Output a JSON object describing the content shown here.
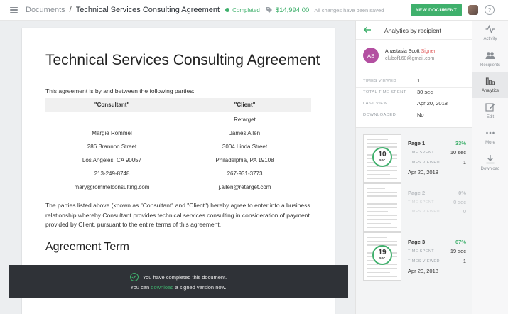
{
  "header": {
    "breadcrumb_root": "Documents",
    "separator": "/",
    "doc_title": "Technical Services Consulting Agreement",
    "status": "Completed",
    "price": "$14,994.00",
    "saved_text": "All changes have been saved",
    "new_document_label": "NEW DOCUMENT",
    "help_label": "?",
    "colors": {
      "accent": "#3fb06c"
    }
  },
  "document": {
    "title": "Technical Services Consulting Agreement",
    "intro": "This agreement is by and between the following parties:",
    "consultant_header": "\"Consultant\"",
    "client_header": "\"Client\"",
    "consultant": [
      "Margie Rommel",
      "286 Brannon Street",
      "Los Angeles, CA 90057",
      "213-249-8748",
      "mary@rommelconsulting.com"
    ],
    "client": [
      "Retarget",
      "James Allen",
      "3004 Linda Street",
      "Philadelphia, PA 19108",
      "267-931-3773",
      "j.allen@retarget.com"
    ],
    "paragraph": "The parties listed above (known as \"Consultant\" and \"Client\") hereby agree to enter into a business relationship whereby Consultant provides technical services consulting in consideration of payment provided by Client, pursuant to the entire terms of this agreement.",
    "section_heading": "Agreement Term"
  },
  "toast": {
    "line1": "You have completed this document.",
    "line2_prefix": "You can ",
    "line2_link": "download",
    "line2_suffix": " a signed version now."
  },
  "analytics": {
    "title": "Analytics by recipient",
    "recipient": {
      "initials": "AS",
      "name": "Anastasia Scott",
      "role": "Signer",
      "email": "clubof160@gmail.com",
      "avatar_color": "#b34fa1"
    },
    "stats": [
      {
        "label": "TIMES VIEWED",
        "value": "1"
      },
      {
        "label": "TOTAL TIME SPENT",
        "value": "30 sec"
      },
      {
        "label": "LAST VIEW",
        "value": "Apr 20, 2018"
      },
      {
        "label": "DOWNLOADED",
        "value": "No"
      }
    ],
    "pages": [
      {
        "name": "Page 1",
        "percent": "33%",
        "time_label": "TIME SPENT",
        "time": "10 sec",
        "views_label": "TIMES VIEWED",
        "views": "1",
        "date": "Apr 20, 2018",
        "ring_value": "10",
        "ring_unit": "sec",
        "viewed": true
      },
      {
        "name": "Page 2",
        "percent": "0%",
        "time_label": "TIME SPENT",
        "time": "0 sec",
        "views_label": "TIMES VIEWED",
        "views": "0",
        "date": "",
        "viewed": false
      },
      {
        "name": "Page 3",
        "percent": "67%",
        "time_label": "TIME SPENT",
        "time": "19 sec",
        "views_label": "TIMES VIEWED",
        "views": "1",
        "date": "Apr 20, 2018",
        "ring_value": "19",
        "ring_unit": "sec",
        "viewed": true
      }
    ]
  },
  "rail": [
    {
      "label": "Activity",
      "icon": "activity-icon",
      "active": false
    },
    {
      "label": "Recipients",
      "icon": "recipients-icon",
      "active": false
    },
    {
      "label": "Analytics",
      "icon": "analytics-icon",
      "active": true
    },
    {
      "label": "Edit",
      "icon": "edit-icon",
      "active": false
    },
    {
      "label": "More",
      "icon": "more-icon",
      "active": false
    },
    {
      "label": "Download",
      "icon": "download-icon",
      "active": false
    }
  ]
}
